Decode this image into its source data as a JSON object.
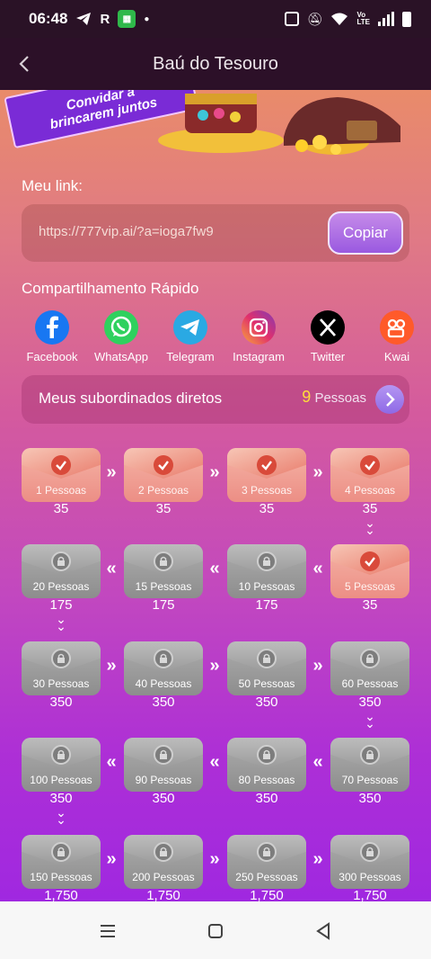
{
  "status_bar": {
    "time": "06:48",
    "r_icon": "R"
  },
  "header": {
    "title": "Baú do Tesouro"
  },
  "banner": {
    "text_line1": "Convidar a",
    "text_line2": "brincarem juntos"
  },
  "link": {
    "label": "Meu link:",
    "url": "https://777vip.ai/?a=ioga7fw9",
    "copy_label": "Copiar"
  },
  "share": {
    "label": "Compartilhamento Rápido",
    "items": [
      {
        "label": "Facebook",
        "icon": "facebook-icon"
      },
      {
        "label": "WhatsApp",
        "icon": "whatsapp-icon"
      },
      {
        "label": "Telegram",
        "icon": "telegram-icon"
      },
      {
        "label": "Instagram",
        "icon": "instagram-icon"
      },
      {
        "label": "Twitter",
        "icon": "x-icon"
      },
      {
        "label": "Kwai",
        "icon": "kwai-icon"
      }
    ]
  },
  "subordinates": {
    "label": "Meus subordinados diretos",
    "count": "9",
    "unit": "Pessoas"
  },
  "chests": [
    {
      "label": "1 Pessoas",
      "reward": "35",
      "state": "open"
    },
    {
      "label": "2 Pessoas",
      "reward": "35",
      "state": "open"
    },
    {
      "label": "3 Pessoas",
      "reward": "35",
      "state": "open"
    },
    {
      "label": "4 Pessoas",
      "reward": "35",
      "state": "open"
    },
    {
      "label": "5 Pessoas",
      "reward": "35",
      "state": "open"
    },
    {
      "label": "10 Pessoas",
      "reward": "175",
      "state": "locked"
    },
    {
      "label": "15 Pessoas",
      "reward": "175",
      "state": "locked"
    },
    {
      "label": "20 Pessoas",
      "reward": "175",
      "state": "locked"
    },
    {
      "label": "30 Pessoas",
      "reward": "350",
      "state": "locked"
    },
    {
      "label": "40 Pessoas",
      "reward": "350",
      "state": "locked"
    },
    {
      "label": "50 Pessoas",
      "reward": "350",
      "state": "locked"
    },
    {
      "label": "60 Pessoas",
      "reward": "350",
      "state": "locked"
    },
    {
      "label": "70 Pessoas",
      "reward": "350",
      "state": "locked"
    },
    {
      "label": "80 Pessoas",
      "reward": "350",
      "state": "locked"
    },
    {
      "label": "90 Pessoas",
      "reward": "350",
      "state": "locked"
    },
    {
      "label": "100 Pessoas",
      "reward": "350",
      "state": "locked"
    },
    {
      "label": "150 Pessoas",
      "reward": "1,750",
      "state": "locked"
    },
    {
      "label": "200 Pessoas",
      "reward": "1,750",
      "state": "locked"
    },
    {
      "label": "250 Pessoas",
      "reward": "1,750",
      "state": "locked"
    },
    {
      "label": "300 Pessoas",
      "reward": "1,750",
      "state": "locked"
    }
  ],
  "colors": {
    "accent": "#9a59e0",
    "highlight": "#ffde3a",
    "header_bg": "#2c1028"
  }
}
